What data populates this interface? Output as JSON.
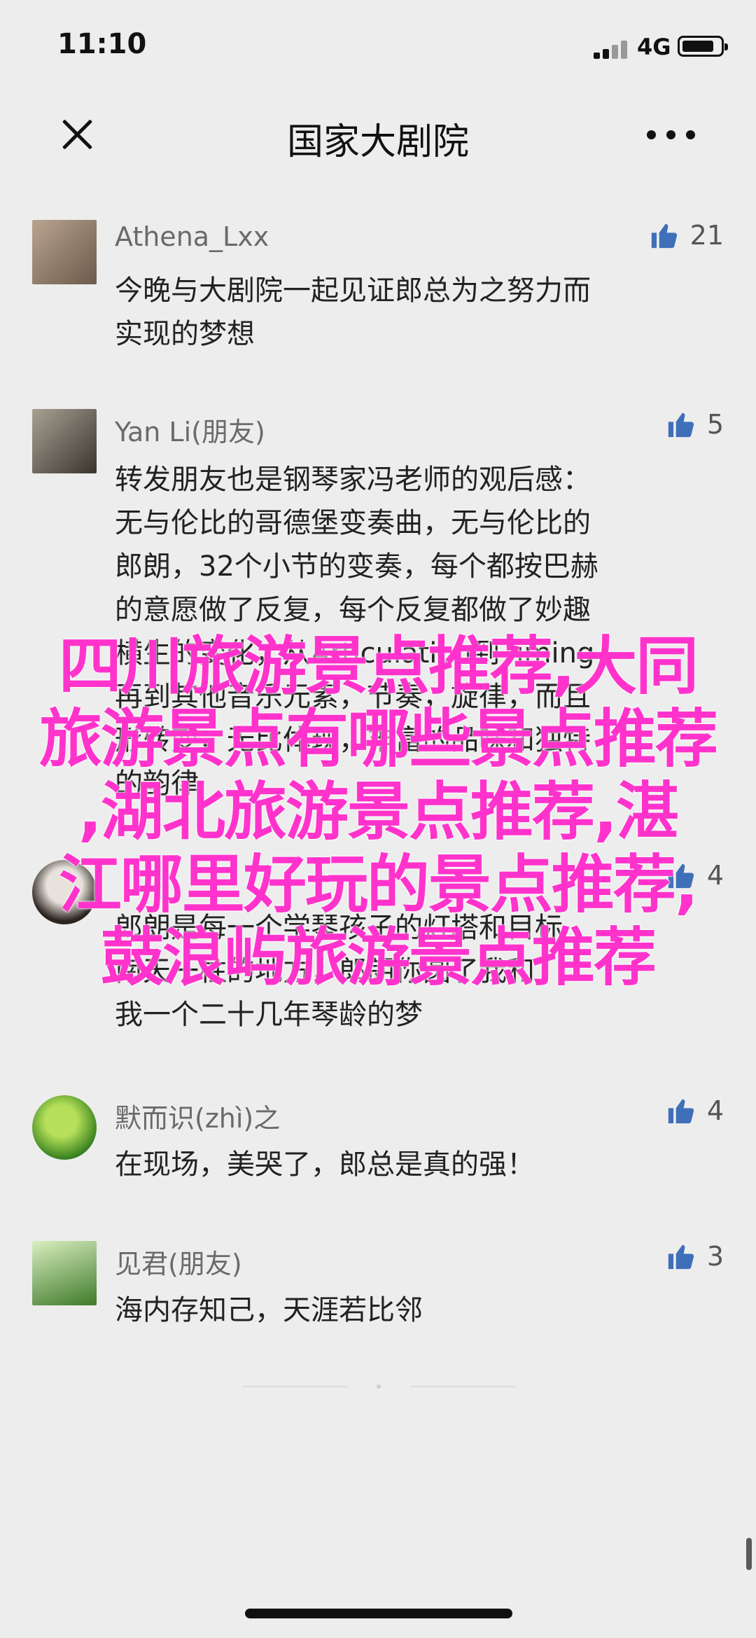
{
  "status_bar": {
    "time": "11:10",
    "network": "4G"
  },
  "nav": {
    "title": "国家大剧院",
    "close_icon": "close-icon",
    "more_icon": "more-icon"
  },
  "comments": [
    {
      "name": "Athena_Lxx",
      "likes": "21",
      "text": "今晚与大剧院一起见证郎总为之努力而\n实现的梦想",
      "avatar_colors": [
        "#b9a48f",
        "#6b5a4b"
      ]
    },
    {
      "name": "Yan Li(朋友)",
      "likes": "5",
      "text": "转发朋友也是钢琴家冯老师的观后感：\n无与伦比的哥德堡变奏曲，无与伦比的\n郎朗，32个小节的变奏，每个都按巴赫\n的意愿做了反复，每个反复都做了妙趣\n横生的变化，从Articulation到Timing，\n再到其他音乐元素，节奏，旋律，而且\n形转变，无比体现，丰富的品味和独特\n的韵律",
      "avatar_colors": [
        "#8f8a7c",
        "#403a33"
      ]
    },
    {
      "name": "",
      "likes": "4",
      "text": "郎朗是每一个学琴孩子的灯塔和目标\n南天一柱的地方，郎朗你圆了我和\n我一个二十几年琴龄的梦",
      "avatar_colors": [
        "#e8e2dc",
        "#2b2420"
      ]
    },
    {
      "name": "默而识(zhì)之",
      "likes": "4",
      "text": "在现场，美哭了，郎总是真的强！",
      "avatar_colors": [
        "#8ac03a",
        "#2e7a1a"
      ]
    },
    {
      "name": "见君(朋友)",
      "likes": "3",
      "text": "海内存知己，天涯若比邻",
      "avatar_colors": [
        "#9fd07a",
        "#3e7a2a"
      ]
    }
  ],
  "overlay": {
    "text": "四川旅游景点推荐,大同\n旅游景点有哪些景点推荐\n,湖北旅游景点推荐,湛\n江哪里好玩的景点推荐,\n鼓浪屿旅游景点推荐"
  },
  "colors": {
    "background": "#ededed",
    "overlay": "#ff33cc",
    "like_icon": "#3f6fb8"
  }
}
